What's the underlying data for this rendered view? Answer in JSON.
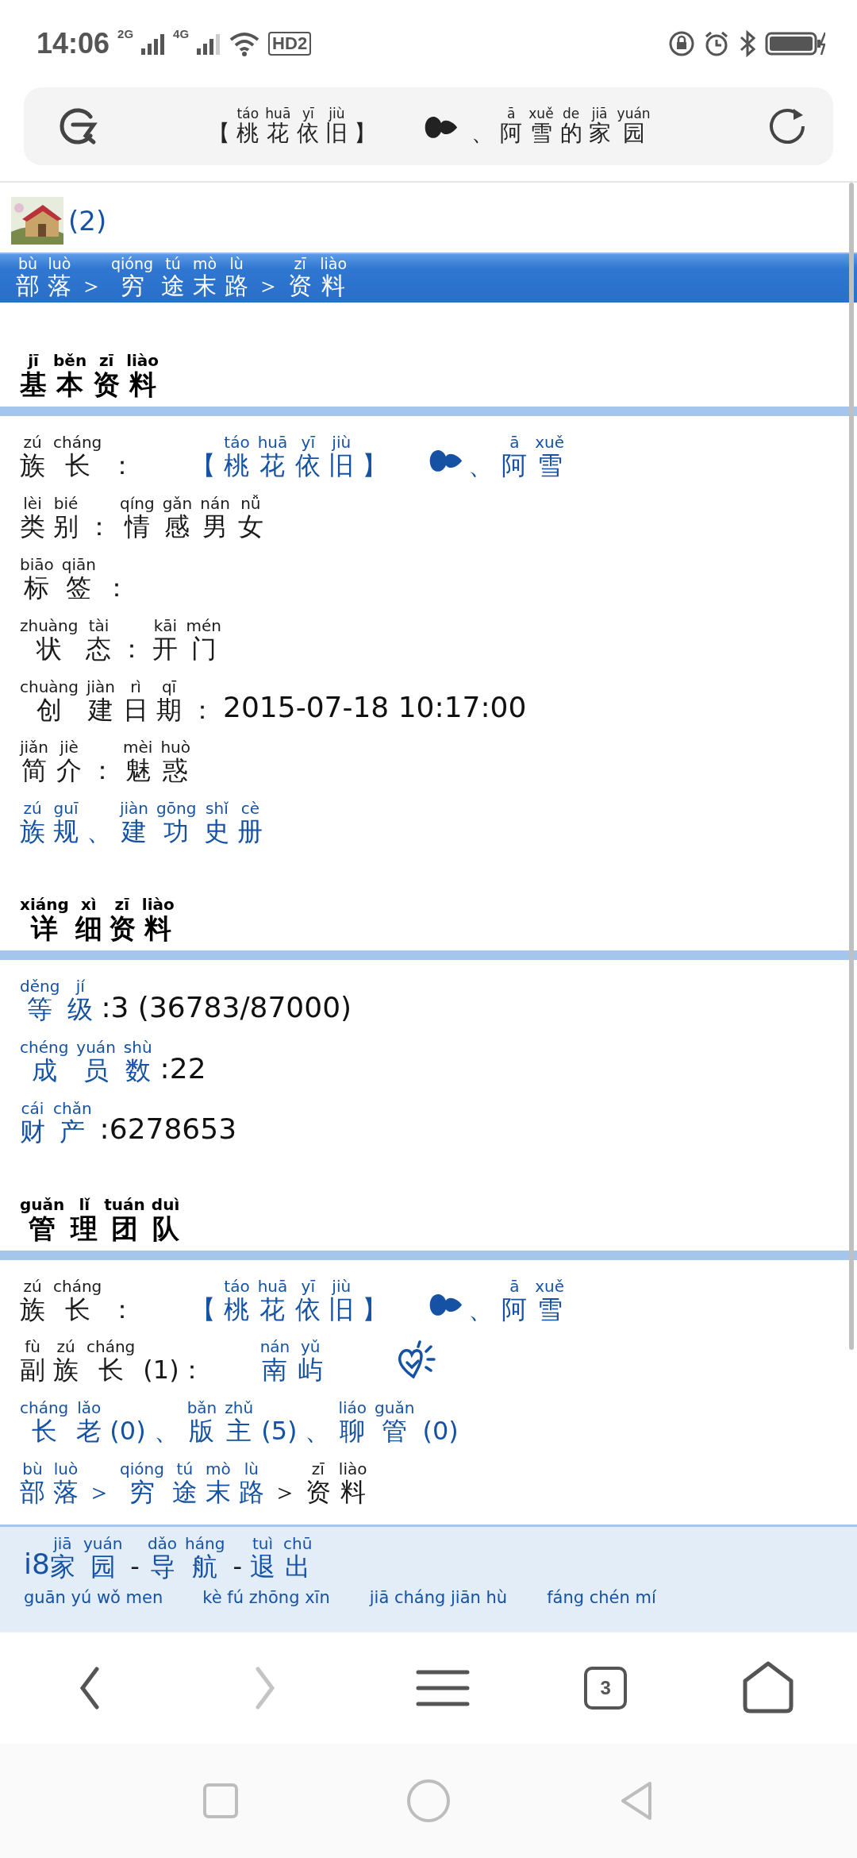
{
  "status_bar": {
    "time": "14:06",
    "sim_labels": [
      "2G",
      "4G"
    ],
    "hd_label": "HD2"
  },
  "address_bar": {
    "title": [
      {
        "kind": "text_ruby",
        "ruby": [
          [
            "【"
          ],
          [
            "táo",
            "桃"
          ],
          [
            "huā",
            "花"
          ],
          [
            "yī",
            "依"
          ],
          [
            "jiù",
            "旧"
          ],
          [
            "】"
          ]
        ]
      },
      {
        "kind": "heart"
      },
      {
        "kind": "text_ruby",
        "ruby": [
          [
            "、"
          ],
          [
            "ā",
            "阿"
          ],
          [
            "xuě",
            "雪"
          ],
          [
            "de",
            "的"
          ],
          [
            "jiā",
            "家"
          ],
          [
            "yuán",
            "园"
          ]
        ]
      }
    ]
  },
  "header": {
    "count": "(2)"
  },
  "breadcrumb": [
    [
      "bù",
      "部"
    ],
    [
      "luò",
      "落"
    ],
    [
      "＞"
    ],
    [
      "qióng",
      "穷"
    ],
    [
      "tú",
      "途"
    ],
    [
      "mò",
      "末"
    ],
    [
      "lù",
      "路"
    ],
    [
      "＞"
    ],
    [
      "zī",
      "资"
    ],
    [
      "liào",
      "料"
    ]
  ],
  "sections": [
    {
      "title": [
        [
          "jī",
          "基"
        ],
        [
          "běn",
          "本"
        ],
        [
          "zī",
          "资"
        ],
        [
          "liào",
          "料"
        ]
      ],
      "rows": [
        [
          {
            "kind": "label",
            "ruby": [
              [
                "zú",
                "族"
              ],
              [
                "cháng",
                "长"
              ],
              [
                "："
              ]
            ]
          },
          {
            "kind": "link",
            "ruby": [
              [
                "【"
              ],
              [
                "táo",
                "桃"
              ],
              [
                "huā",
                "花"
              ],
              [
                "yī",
                "依"
              ],
              [
                "jiù",
                "旧"
              ],
              [
                "】"
              ]
            ]
          },
          {
            "kind": "heart"
          },
          {
            "kind": "link",
            "ruby": [
              [
                "、"
              ],
              [
                "ā",
                "阿"
              ],
              [
                "xuě",
                "雪"
              ]
            ]
          }
        ],
        [
          {
            "kind": "label",
            "ruby": [
              [
                "lèi",
                "类"
              ],
              [
                "bié",
                "别"
              ],
              [
                "："
              ],
              [
                "qíng",
                "情"
              ],
              [
                "gǎn",
                "感"
              ],
              [
                "nán",
                "男"
              ],
              [
                "nǚ",
                "女"
              ]
            ]
          }
        ],
        [
          {
            "kind": "label",
            "ruby": [
              [
                "biāo",
                "标"
              ],
              [
                "qiān",
                "签"
              ],
              [
                "："
              ]
            ]
          }
        ],
        [
          {
            "kind": "label",
            "ruby": [
              [
                "zhuàng",
                "状"
              ],
              [
                "tài",
                "态"
              ],
              [
                "："
              ],
              [
                "kāi",
                "开"
              ],
              [
                "mén",
                "门"
              ]
            ]
          }
        ],
        [
          {
            "kind": "label",
            "ruby": [
              [
                "chuàng",
                "创"
              ],
              [
                "jiàn",
                "建"
              ],
              [
                "rì",
                "日"
              ],
              [
                "qī",
                "期"
              ],
              [
                "："
              ]
            ]
          },
          {
            "kind": "text",
            "text": "2015-07-18 10:17:00"
          }
        ],
        [
          {
            "kind": "label",
            "ruby": [
              [
                "jiǎn",
                "简"
              ],
              [
                "jiè",
                "介"
              ],
              [
                "："
              ],
              [
                "mèi",
                "魅"
              ],
              [
                "huò",
                "惑"
              ]
            ]
          }
        ],
        [
          {
            "kind": "link",
            "ruby": [
              [
                "zú",
                "族"
              ],
              [
                "guī",
                "规"
              ]
            ]
          },
          {
            "kind": "link",
            "ruby": [
              [
                "、"
              ],
              [
                "jiàn",
                "建"
              ],
              [
                "gōng",
                "功"
              ],
              [
                "shǐ",
                "史"
              ],
              [
                "cè",
                "册"
              ]
            ]
          }
        ]
      ]
    },
    {
      "title": [
        [
          "xiáng",
          "详"
        ],
        [
          "xì",
          "细"
        ],
        [
          "zī",
          "资"
        ],
        [
          "liào",
          "料"
        ]
      ],
      "rows": [
        [
          {
            "kind": "link",
            "ruby": [
              [
                "děng",
                "等"
              ],
              [
                "jí",
                "级"
              ]
            ]
          },
          {
            "kind": "text",
            "text": ":3 (36783/87000)"
          }
        ],
        [
          {
            "kind": "link",
            "ruby": [
              [
                "chéng",
                "成"
              ],
              [
                "yuán",
                "员"
              ],
              [
                "shù",
                "数"
              ]
            ]
          },
          {
            "kind": "text",
            "text": ":22"
          }
        ],
        [
          {
            "kind": "link",
            "ruby": [
              [
                "cái",
                "财"
              ],
              [
                "chǎn",
                "产"
              ]
            ]
          },
          {
            "kind": "text",
            "text": ":6278653"
          }
        ]
      ]
    },
    {
      "title": [
        [
          "guǎn",
          "管"
        ],
        [
          "lǐ",
          "理"
        ],
        [
          "tuán",
          "团"
        ],
        [
          "duì",
          "队"
        ]
      ],
      "rows": [
        [
          {
            "kind": "label",
            "ruby": [
              [
                "zú",
                "族"
              ],
              [
                "cháng",
                "长"
              ],
              [
                "："
              ]
            ]
          },
          {
            "kind": "link",
            "ruby": [
              [
                "【"
              ],
              [
                "táo",
                "桃"
              ],
              [
                "huā",
                "花"
              ],
              [
                "yī",
                "依"
              ],
              [
                "jiù",
                "旧"
              ],
              [
                "】"
              ]
            ]
          },
          {
            "kind": "heart"
          },
          {
            "kind": "link",
            "ruby": [
              [
                "、"
              ],
              [
                "ā",
                "阿"
              ],
              [
                "xuě",
                "雪"
              ]
            ]
          }
        ],
        [
          {
            "kind": "label",
            "ruby": [
              [
                "fù",
                "副"
              ],
              [
                "zú",
                "族"
              ],
              [
                "cháng",
                "长"
              ],
              [
                "(1)："
              ]
            ]
          },
          {
            "kind": "link",
            "ruby": [
              [
                "nán",
                "南"
              ],
              [
                "yǔ",
                "屿"
              ]
            ]
          },
          {
            "kind": "radiant_heart"
          }
        ],
        [
          {
            "kind": "link",
            "ruby": [
              [
                "cháng",
                "长"
              ],
              [
                "lǎo",
                "老"
              ],
              [
                "(0)"
              ]
            ]
          },
          {
            "kind": "link",
            "ruby": [
              [
                "、"
              ],
              [
                "bǎn",
                "版"
              ],
              [
                "zhǔ",
                "主"
              ],
              [
                "(5)"
              ]
            ]
          },
          {
            "kind": "link",
            "ruby": [
              [
                "、"
              ],
              [
                "liáo",
                "聊"
              ],
              [
                "guǎn",
                "管"
              ],
              [
                "(0)"
              ]
            ]
          }
        ],
        [
          {
            "kind": "link",
            "ruby": [
              [
                "bù",
                "部"
              ],
              [
                "luò",
                "落"
              ]
            ]
          },
          {
            "kind": "link",
            "ruby": [
              [
                "＞"
              ],
              [
                "qióng",
                "穷"
              ],
              [
                "tú",
                "途"
              ],
              [
                "mò",
                "末"
              ],
              [
                "lù",
                "路"
              ]
            ]
          },
          {
            "kind": "label",
            "ruby": [
              [
                "＞"
              ],
              [
                "zī",
                "资"
              ],
              [
                "liào",
                "料"
              ]
            ]
          }
        ]
      ]
    }
  ],
  "footer": {
    "parts": [
      {
        "kind": "text",
        "text": "i8"
      },
      {
        "kind": "link",
        "ruby": [
          [
            "jiā",
            "家"
          ],
          [
            "yuán",
            "园"
          ]
        ]
      },
      {
        "kind": "label",
        "ruby": [
          [
            "-"
          ]
        ]
      },
      {
        "kind": "link",
        "ruby": [
          [
            "dǎo",
            "导"
          ],
          [
            "háng",
            "航"
          ]
        ]
      },
      {
        "kind": "label",
        "ruby": [
          [
            "-"
          ]
        ]
      },
      {
        "kind": "link",
        "ruby": [
          [
            "tuì",
            "退"
          ],
          [
            "chū",
            "出"
          ]
        ]
      }
    ],
    "cut_links": [
      "guān yú wǒ men",
      "kè fú zhōng xīn",
      "jiā cháng jiān hù",
      "fáng chén mí"
    ]
  },
  "browser_nav": {
    "forward_disabled": true,
    "tabs_count": "3"
  }
}
